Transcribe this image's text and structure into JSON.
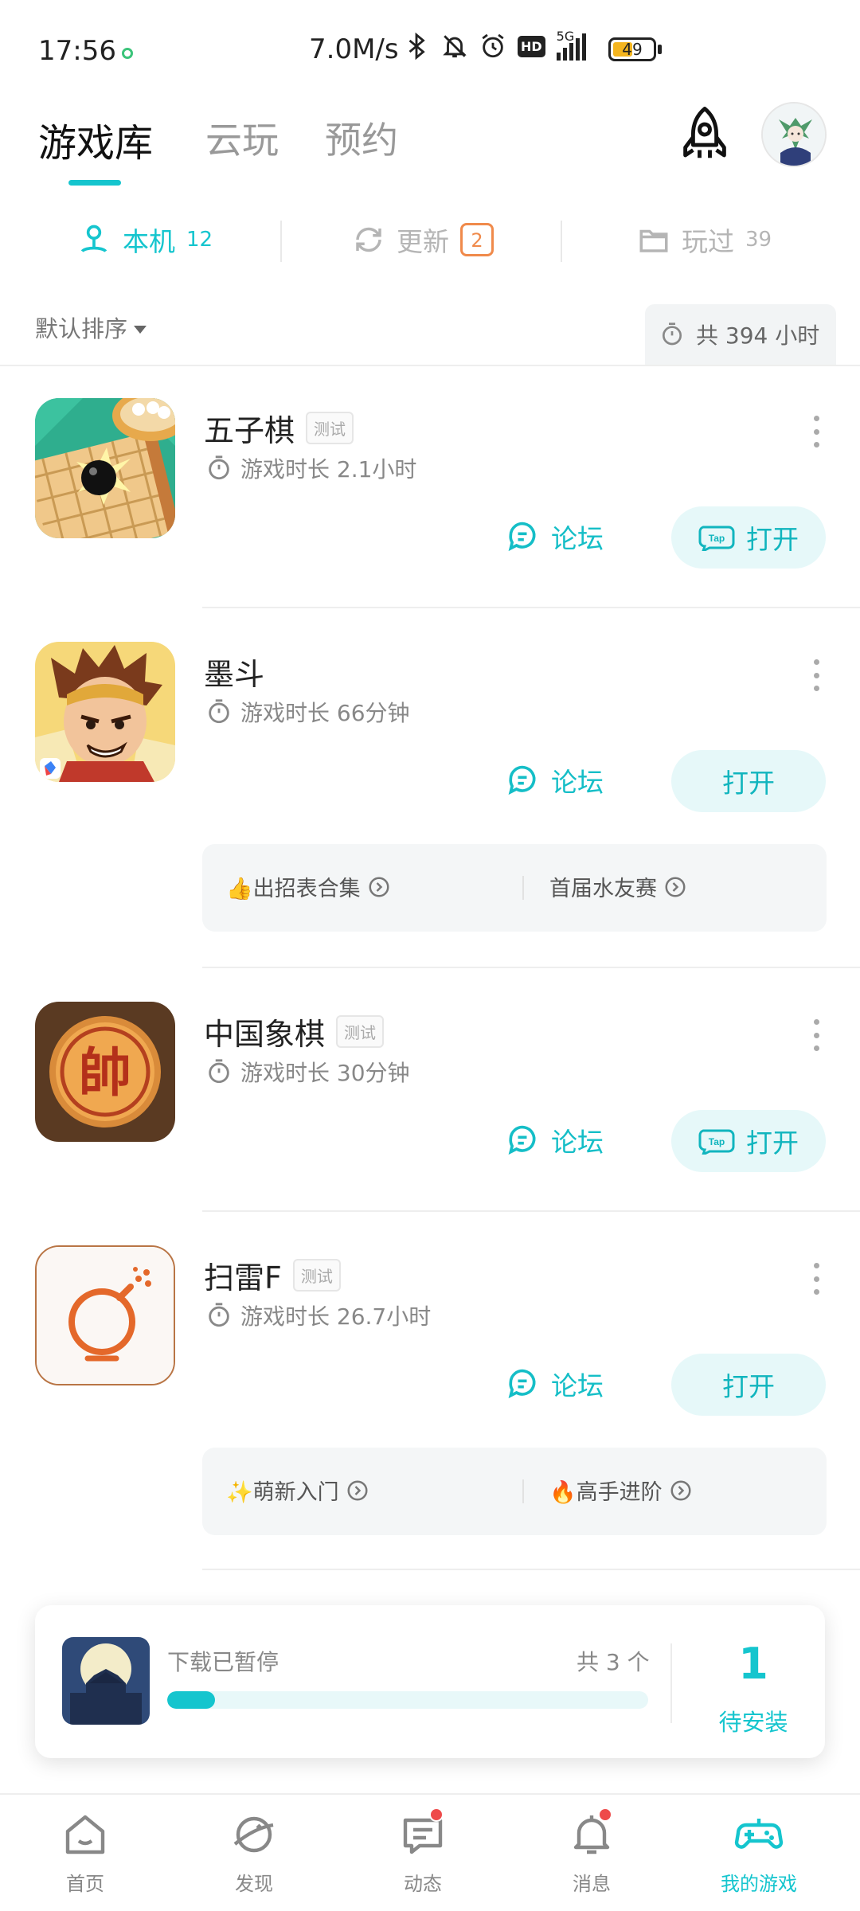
{
  "status_bar": {
    "time": "17:56",
    "net_speed": "7.0M/s",
    "network": "5G",
    "hd": "HD",
    "battery": "49",
    "battery_level": 0.49
  },
  "header": {
    "tabs": [
      {
        "label": "游戏库",
        "active": true
      },
      {
        "label": "云玩",
        "active": false
      },
      {
        "label": "预约",
        "active": false
      }
    ]
  },
  "subtabs": {
    "local": {
      "label": "本机",
      "count": "12"
    },
    "update": {
      "label": "更新",
      "count": "2"
    },
    "played": {
      "label": "玩过",
      "count": "39"
    }
  },
  "sort": {
    "label": "默认排序"
  },
  "total_time": {
    "label": "共 394 小时"
  },
  "games": [
    {
      "name": "五子棋",
      "tag": "测试",
      "playtime": "游戏时长 2.1小时",
      "forum": "论坛",
      "open": "打开",
      "tap_logo": "Tap",
      "has_tap": true
    },
    {
      "name": "墨斗",
      "playtime": "游戏时长 66分钟",
      "forum": "论坛",
      "open": "打开",
      "has_tap": false,
      "strategies": [
        "👍出招表合集",
        "首届水友赛"
      ]
    },
    {
      "name": "中国象棋",
      "tag": "测试",
      "playtime": "游戏时长 30分钟",
      "forum": "论坛",
      "open": "打开",
      "tap_logo": "Tap",
      "has_tap": true,
      "icon_char": "帥"
    },
    {
      "name": "扫雷F",
      "tag": "测试",
      "playtime": "游戏时长 26.7小时",
      "forum": "论坛",
      "open": "打开",
      "has_tap": false,
      "strategies": [
        "✨萌新入门",
        "🔥高手进阶"
      ]
    }
  ],
  "download": {
    "status": "下载已暂停",
    "count": "共 3 个",
    "progress": 0.1,
    "pending_num": "1",
    "pending_label": "待安装"
  },
  "bottom_nav": [
    {
      "label": "首页",
      "icon": "home-icon",
      "dot": false,
      "active": false
    },
    {
      "label": "发现",
      "icon": "discover-icon",
      "dot": false,
      "active": false
    },
    {
      "label": "动态",
      "icon": "feed-icon",
      "dot": true,
      "active": false
    },
    {
      "label": "消息",
      "icon": "bell-icon",
      "dot": true,
      "active": false
    },
    {
      "label": "我的游戏",
      "icon": "gamepad-icon",
      "dot": false,
      "active": true
    }
  ],
  "colors": {
    "accent": "#15c5ce",
    "badge_orange": "#f08a4b",
    "notification_red": "#ee4b4b"
  }
}
